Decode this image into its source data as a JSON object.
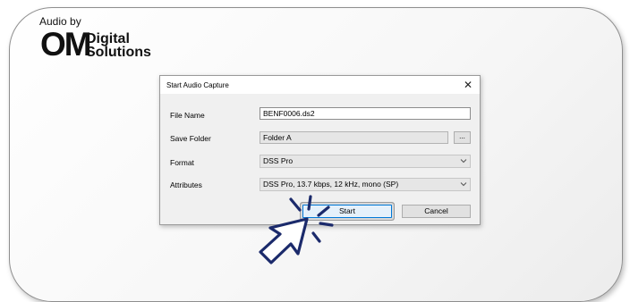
{
  "brand": {
    "tagline": "Audio by",
    "mark": "OM",
    "name_line1": "Digital",
    "name_line2": "Solutions"
  },
  "dialog": {
    "title": "Start Audio Capture",
    "close_glyph": "✕",
    "file_name": {
      "label": "File Name",
      "value": "BENF0006.ds2"
    },
    "save_folder": {
      "label": "Save Folder",
      "value": "Folder A",
      "browse_label": "..."
    },
    "format": {
      "label": "Format",
      "value": "DSS Pro"
    },
    "attributes": {
      "label": "Attributes",
      "value": "DSS Pro, 13.7 kbps, 12 kHz, mono (SP)"
    },
    "start_label": "Start",
    "cancel_label": "Cancel"
  },
  "colors": {
    "accent": "#0078d7",
    "pointer": "#1b2a6b"
  },
  "icons": {
    "pointer": "hand-pointer-click-icon",
    "close": "close-icon",
    "chevron": "chevron-down-icon"
  }
}
